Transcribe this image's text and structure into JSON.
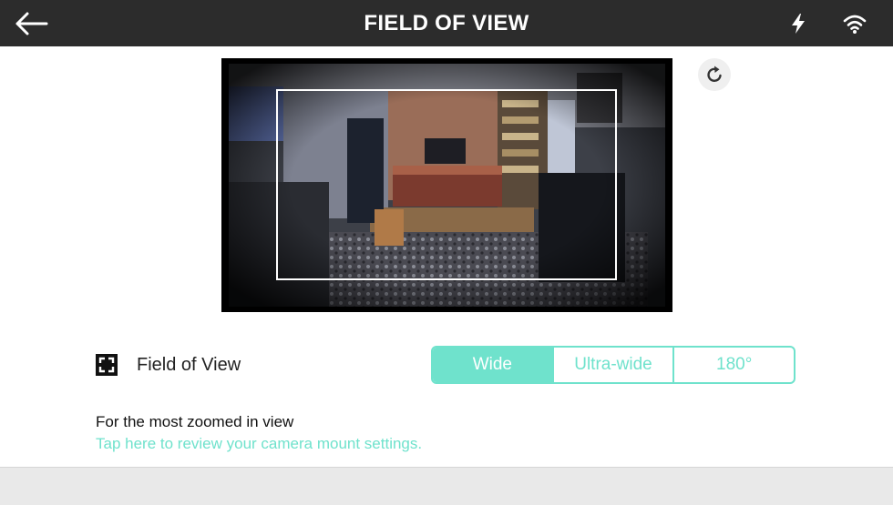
{
  "header": {
    "title": "FIELD OF VIEW",
    "back_icon": "arrow-left-icon",
    "status_icons": [
      "flash-icon",
      "wifi-icon"
    ]
  },
  "preview": {
    "refresh_icon": "refresh-icon"
  },
  "field_of_view": {
    "icon": "fullscreen-corners-icon",
    "label": "Field of View",
    "options": [
      "Wide",
      "Ultra-wide",
      "180°"
    ],
    "selected": "Wide"
  },
  "info": {
    "text": "For the most zoomed in view",
    "link": "Tap here to review your camera mount settings."
  },
  "colors": {
    "accent": "#6fe2cc",
    "header_bg": "#2c2c2c",
    "footer_bg": "#e9e9e9"
  }
}
